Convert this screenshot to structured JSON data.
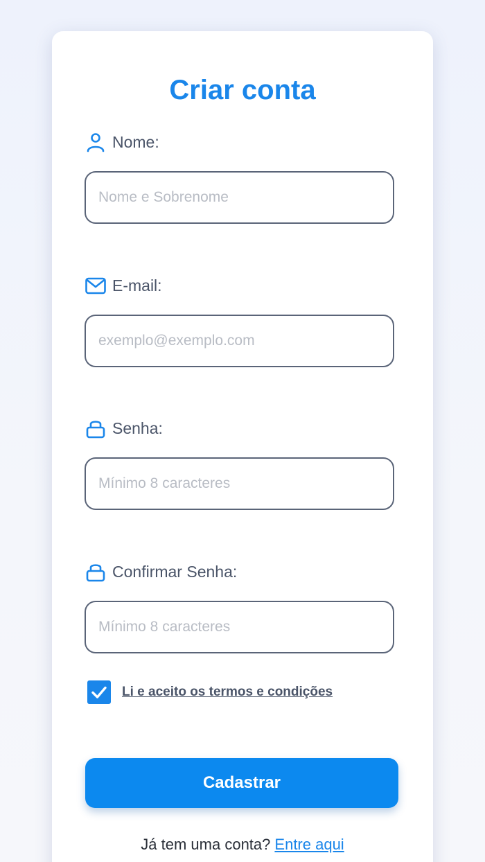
{
  "form": {
    "title": "Criar conta",
    "fields": [
      {
        "label": "Nome:",
        "icon": "user-icon",
        "placeholder": "Nome e Sobrenome",
        "value": ""
      },
      {
        "label": "E-mail:",
        "icon": "mail-icon",
        "placeholder": "exemplo@exemplo.com",
        "value": ""
      },
      {
        "label": "Senha:",
        "icon": "lock-icon",
        "placeholder": "Mínimo 8 caracteres",
        "value": ""
      },
      {
        "label": "Confirmar Senha:",
        "icon": "lock-icon",
        "placeholder": "Mínimo 8 caracteres",
        "value": ""
      }
    ],
    "terms": {
      "checked": true,
      "label": "Li e aceito os termos e condições"
    },
    "submit_label": "Cadastrar",
    "login_prompt": "Já tem uma conta?",
    "login_link": "Entre aqui"
  },
  "colors": {
    "accent": "#1a86ea",
    "button": "#0c89ef",
    "label_text": "#4a5468",
    "field_border": "#5a6478"
  }
}
